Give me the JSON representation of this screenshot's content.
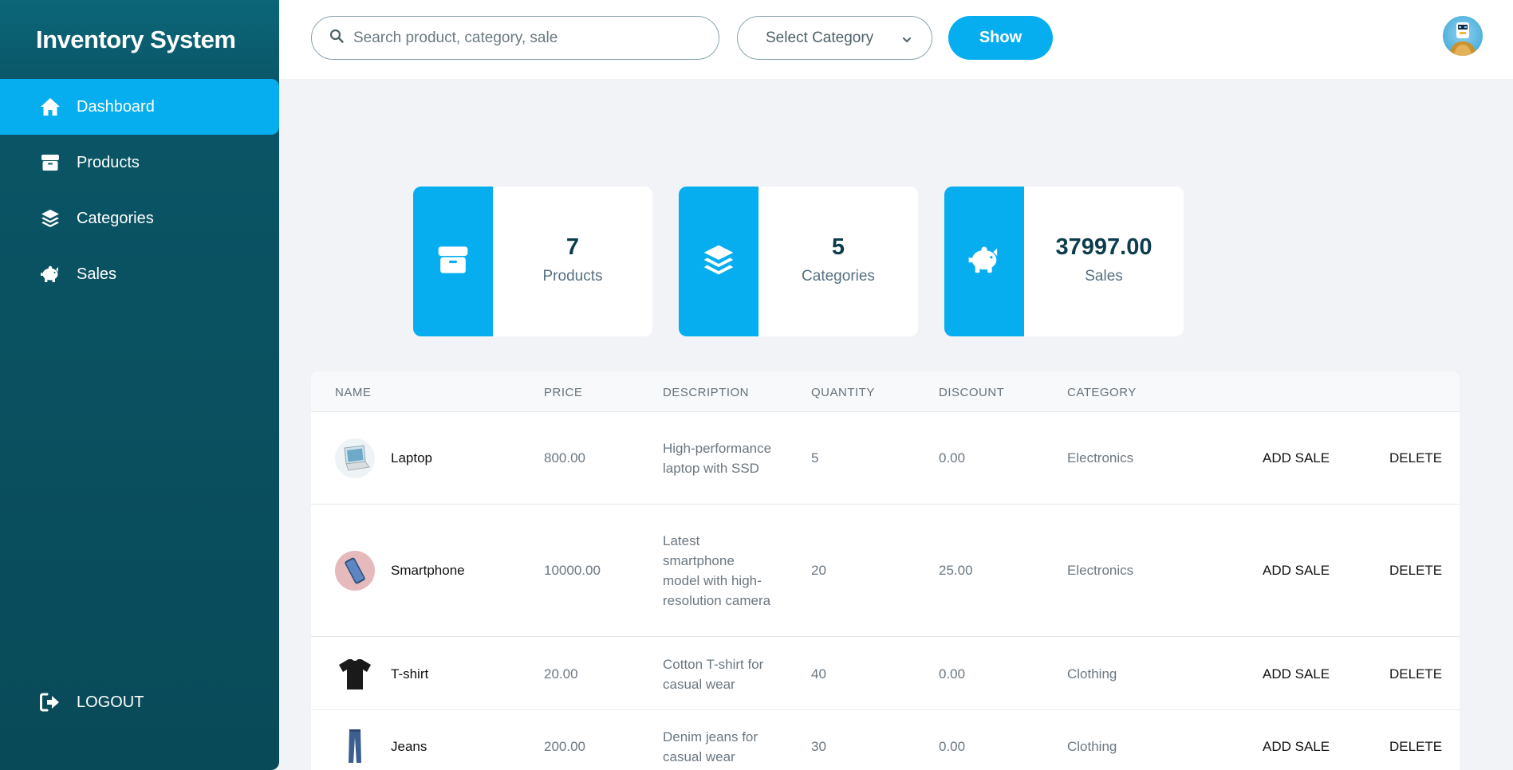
{
  "sidebar": {
    "brand": "Inventory System",
    "items": [
      {
        "label": "Dashboard",
        "icon": "home-icon"
      },
      {
        "label": "Products",
        "icon": "box-icon"
      },
      {
        "label": "Categories",
        "icon": "layers-icon"
      },
      {
        "label": "Sales",
        "icon": "piggy-bank-icon"
      }
    ],
    "logout": "LOGOUT"
  },
  "topbar": {
    "search_placeholder": "Search product, category, sale",
    "select_label": "Select Category",
    "show_label": "Show"
  },
  "stats": [
    {
      "value": "7",
      "label": "Products",
      "icon": "box-icon"
    },
    {
      "value": "5",
      "label": "Categories",
      "icon": "layers-icon"
    },
    {
      "value": "37997.00",
      "label": "Sales",
      "icon": "piggy-bank-icon"
    }
  ],
  "table": {
    "headers": [
      "NAME",
      "PRICE",
      "DESCRIPTION",
      "QUANTITY",
      "DISCOUNT",
      "CATEGORY"
    ],
    "add_sale_label": "ADD SALE",
    "delete_label": "DELETE",
    "rows": [
      {
        "name": "Laptop",
        "price": "800.00",
        "description": "High-performance laptop with SSD",
        "quantity": "5",
        "discount": "0.00",
        "category": "Electronics"
      },
      {
        "name": "Smartphone",
        "price": "10000.00",
        "description": "Latest smartphone model with high-resolution camera",
        "quantity": "20",
        "discount": "25.00",
        "category": "Electronics"
      },
      {
        "name": "T-shirt",
        "price": "20.00",
        "description": "Cotton T-shirt for casual wear",
        "quantity": "40",
        "discount": "0.00",
        "category": "Clothing"
      },
      {
        "name": "Jeans",
        "price": "200.00",
        "description": "Denim jeans for casual wear",
        "quantity": "30",
        "discount": "0.00",
        "category": "Clothing"
      }
    ]
  },
  "colors": {
    "accent": "#06aef0",
    "sidebar": "#094a58"
  }
}
